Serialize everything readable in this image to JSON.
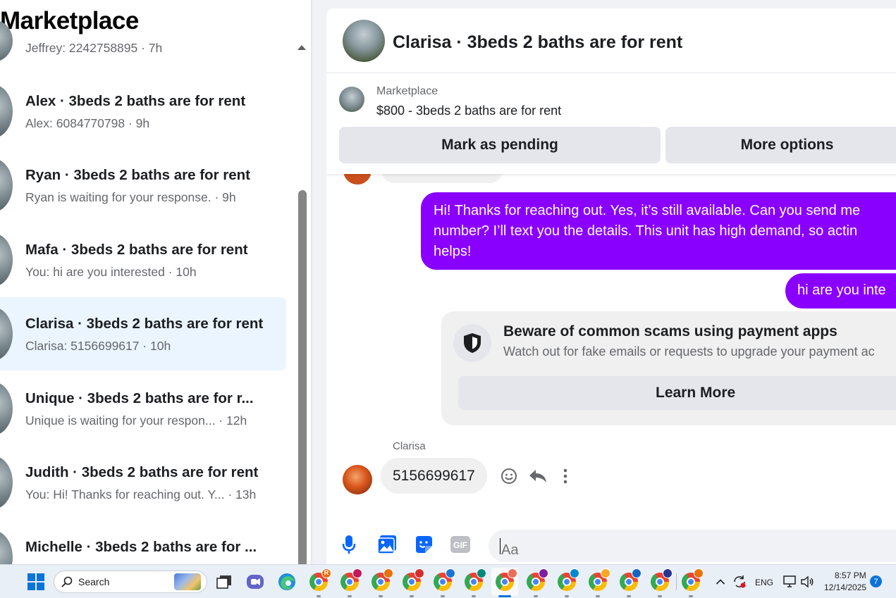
{
  "sidebar": {
    "title": "Marketplace",
    "conversations": [
      {
        "name": "",
        "preview": "Jeffrey: 2242758895 · 7h"
      },
      {
        "name": "Alex · 3beds 2 baths are for rent",
        "preview": "Alex: 6084770798 · 9h"
      },
      {
        "name": "Ryan · 3beds 2 baths are for rent",
        "preview": "Ryan is waiting for your response. · 9h"
      },
      {
        "name": "Mafa · 3beds 2 baths are for rent",
        "preview": "You: hi are you interested · 10h"
      },
      {
        "name": "Clarisa · 3beds 2 baths are for rent",
        "preview": "Clarisa: 5156699617 · 10h",
        "active": true
      },
      {
        "name": "Unique · 3beds 2 baths are for r...",
        "preview": "Unique is waiting for your respon... · 12h"
      },
      {
        "name": "Judith · 3beds 2 baths are for rent",
        "preview": "You: Hi! Thanks for reaching out. Y... · 13h"
      },
      {
        "name": "Michelle · 3beds 2 baths are for ...",
        "preview": ""
      }
    ]
  },
  "chat": {
    "header_title": "Clarisa · 3beds 2 baths are for rent",
    "listing": {
      "label": "Marketplace",
      "price_title": "$800 - 3beds 2 baths are for rent",
      "mark_pending_label": "Mark as pending",
      "more_options_label": "More options"
    },
    "messages_out": [
      "Hi! Thanks for reaching out. Yes, it’s still available. Can you send me\nnumber? I’ll text you the details. This unit has high demand, so actin\nhelps!",
      "hi are you inte"
    ],
    "warning": {
      "icon": "shield-icon",
      "title": "Beware of common scams using payment apps",
      "text": "Watch out for fake emails or requests to upgrade your payment ac",
      "button_label": "Learn More"
    },
    "incoming": {
      "sender": "Clarisa",
      "text": "5156699617"
    },
    "composer": {
      "placeholder": "Aa",
      "icons": [
        "microphone-icon",
        "photo-icon",
        "sticker-icon",
        "gif-icon"
      ],
      "gif_label": "GIF"
    }
  },
  "taskbar": {
    "search_label": "Search",
    "chrome_profile_badge": "R",
    "language": "ENG",
    "time": "8:57 PM",
    "date": "12/14/2025",
    "notification_count": "7"
  },
  "colors": {
    "accent_purple": "#8a00ff",
    "active_row": "#ebf5ff",
    "secondary_text": "#65676b",
    "windows_blue": "#0a74da"
  }
}
